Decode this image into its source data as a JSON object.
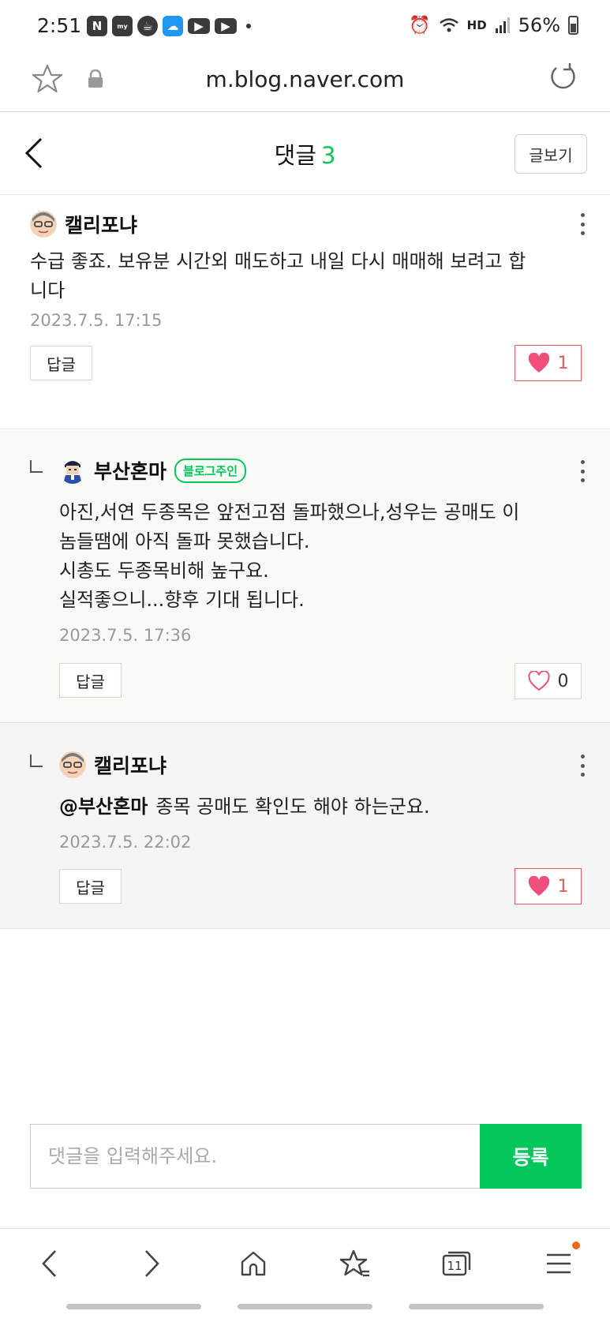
{
  "status_bar": {
    "time": "2:51",
    "network": "HD",
    "battery": "56%",
    "icons": [
      "naver-icon",
      "myfinance-icon",
      "coffee-icon",
      "cloud-icon",
      "youtube-icon",
      "youtube-icon"
    ]
  },
  "browser": {
    "url": "m.blog.naver.com"
  },
  "header": {
    "title": "댓글",
    "count": "3",
    "view_post_label": "글보기"
  },
  "comments": [
    {
      "author": "캘리포냐",
      "text": "수급 좋죠. 보유분 시간외 매도하고 내일 다시 매매해 보려고 합\n니다",
      "date": "2023.7.5. 17:15",
      "reply_label": "답글",
      "likes": "1",
      "liked": true
    },
    {
      "author": "부산혼마",
      "badge": "블로그주인",
      "text": "아진,서연 두종목은 앞전고점 돌파했으나,성우는 공매도 이\n놈들땜에 아직 돌파 못했습니다.\n시총도 두종목비해 높구요.\n실적좋으니...향후 기대 됩니다.",
      "date": "2023.7.5. 17:36",
      "reply_label": "답글",
      "likes": "0",
      "liked": false
    },
    {
      "author": "캘리포냐",
      "mention": "@부산혼마",
      "text": "종목 공매도 확인도 해야 하는군요.",
      "date": "2023.7.5. 22:02",
      "reply_label": "답글",
      "likes": "1",
      "liked": true
    }
  ],
  "input": {
    "placeholder": "댓글을 입력해주세요.",
    "submit_label": "등록"
  },
  "bottom_nav": {
    "tabs_count": "11"
  },
  "colors": {
    "accent": "#03c75a",
    "like": "#ef4f7a"
  }
}
